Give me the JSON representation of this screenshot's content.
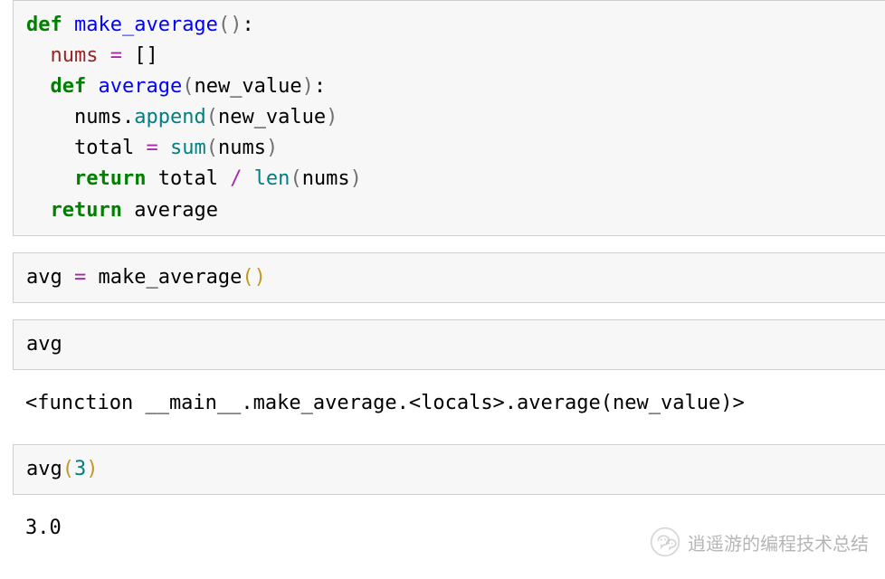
{
  "cells": [
    {
      "type": "code",
      "tokens": [
        [
          {
            "t": "def ",
            "c": "kw"
          },
          {
            "t": "make_average",
            "c": "fn"
          },
          {
            "t": "(",
            "c": "pnG"
          },
          {
            "t": ")",
            "c": "pnG"
          },
          {
            "t": ":",
            "c": "plain"
          }
        ],
        [
          {
            "t": "  ",
            "c": "plain"
          },
          {
            "t": "nums",
            "c": "nm"
          },
          {
            "t": " ",
            "c": "plain"
          },
          {
            "t": "=",
            "c": "op"
          },
          {
            "t": " []",
            "c": "plain"
          }
        ],
        [
          {
            "t": "  ",
            "c": "plain"
          },
          {
            "t": "def ",
            "c": "kw"
          },
          {
            "t": "average",
            "c": "fn"
          },
          {
            "t": "(",
            "c": "pnG"
          },
          {
            "t": "new_value",
            "c": "plain"
          },
          {
            "t": ")",
            "c": "pnG"
          },
          {
            "t": ":",
            "c": "plain"
          }
        ],
        [
          {
            "t": "    nums",
            "c": "plain"
          },
          {
            "t": ".",
            "c": "plain"
          },
          {
            "t": "append",
            "c": "call"
          },
          {
            "t": "(",
            "c": "pnG"
          },
          {
            "t": "new_value",
            "c": "plain"
          },
          {
            "t": ")",
            "c": "pnG"
          }
        ],
        [
          {
            "t": "    total ",
            "c": "plain"
          },
          {
            "t": "=",
            "c": "op"
          },
          {
            "t": " ",
            "c": "plain"
          },
          {
            "t": "sum",
            "c": "call"
          },
          {
            "t": "(",
            "c": "pnG"
          },
          {
            "t": "nums",
            "c": "plain"
          },
          {
            "t": ")",
            "c": "pnG"
          }
        ],
        [
          {
            "t": "    ",
            "c": "plain"
          },
          {
            "t": "return",
            "c": "kw"
          },
          {
            "t": " total ",
            "c": "plain"
          },
          {
            "t": "/",
            "c": "op"
          },
          {
            "t": " ",
            "c": "plain"
          },
          {
            "t": "len",
            "c": "call"
          },
          {
            "t": "(",
            "c": "pnG"
          },
          {
            "t": "nums",
            "c": "plain"
          },
          {
            "t": ")",
            "c": "pnG"
          }
        ],
        [
          {
            "t": "  ",
            "c": "plain"
          },
          {
            "t": "return",
            "c": "kw"
          },
          {
            "t": " average",
            "c": "plain"
          }
        ]
      ]
    },
    {
      "type": "code",
      "tokens": [
        [
          {
            "t": "avg ",
            "c": "plain"
          },
          {
            "t": "=",
            "c": "op"
          },
          {
            "t": " make_average",
            "c": "plain"
          },
          {
            "t": "(",
            "c": "pnO"
          },
          {
            "t": ")",
            "c": "pnO"
          }
        ]
      ]
    },
    {
      "type": "code",
      "tokens": [
        [
          {
            "t": "avg",
            "c": "plain"
          }
        ]
      ]
    },
    {
      "type": "output",
      "text": "<function __main__.make_average.<locals>.average(new_value)>"
    },
    {
      "type": "code",
      "tokens": [
        [
          {
            "t": "avg",
            "c": "plain"
          },
          {
            "t": "(",
            "c": "pnO"
          },
          {
            "t": "3",
            "c": "num"
          },
          {
            "t": ")",
            "c": "pnO"
          }
        ]
      ]
    },
    {
      "type": "output",
      "text": "3.0"
    }
  ],
  "watermark": {
    "text": "逍遥游的编程技术总结",
    "icon": "wechat-icon"
  }
}
